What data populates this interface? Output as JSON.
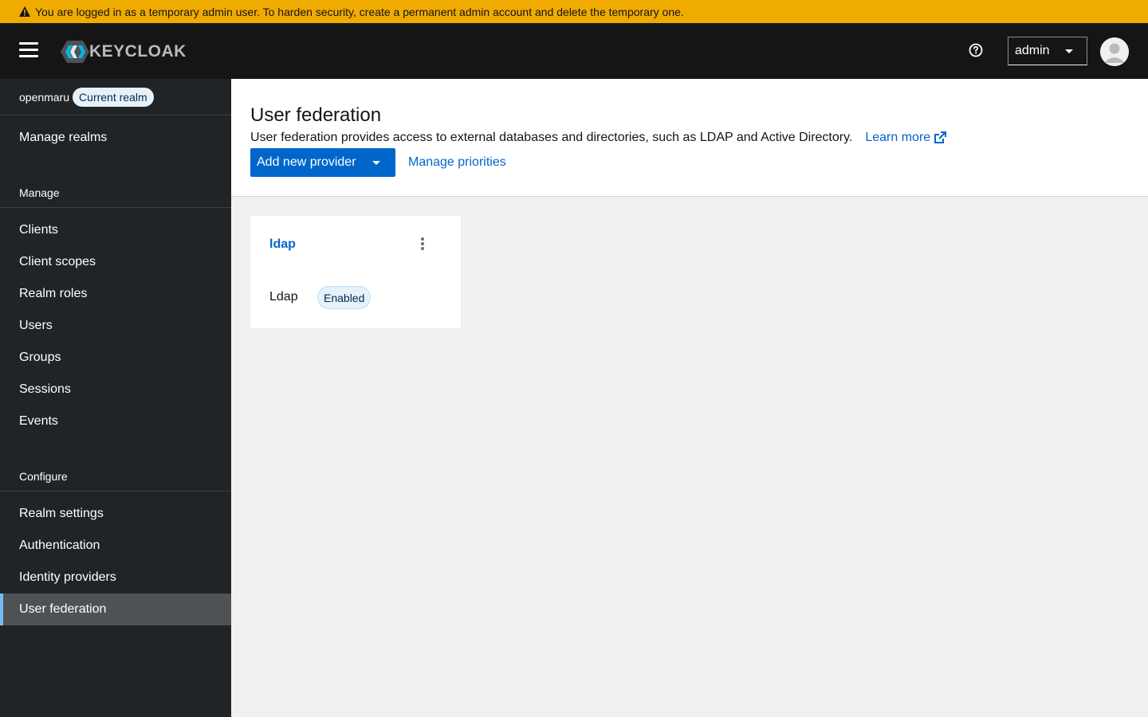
{
  "banner": {
    "icon": "warning-icon",
    "message": "You are logged in as a temporary admin user. To harden security, create a permanent admin account and delete the temporary one."
  },
  "masthead": {
    "logo_text": "KEYCLOAK",
    "user": "admin"
  },
  "sidebar": {
    "realm_name": "openmaru",
    "realm_badge": "Current realm",
    "manage_realms": "Manage realms",
    "sections": {
      "manage": "Manage",
      "configure": "Configure"
    },
    "manage_items": [
      {
        "label": "Clients"
      },
      {
        "label": "Client scopes"
      },
      {
        "label": "Realm roles"
      },
      {
        "label": "Users"
      },
      {
        "label": "Groups"
      },
      {
        "label": "Sessions"
      },
      {
        "label": "Events"
      }
    ],
    "configure_items": [
      {
        "label": "Realm settings"
      },
      {
        "label": "Authentication"
      },
      {
        "label": "Identity providers"
      },
      {
        "label": "User federation"
      }
    ],
    "active_item": "User federation"
  },
  "page": {
    "title": "User federation",
    "description": "User federation provides access to external databases and directories, such as LDAP and Active Directory.",
    "learn_more": "Learn more",
    "add_provider_label": "Add new provider",
    "manage_priorities_label": "Manage priorities"
  },
  "providers": [
    {
      "name": "ldap",
      "type": "Ldap",
      "status": "Enabled"
    }
  ],
  "colors": {
    "banner": "#f0ab00",
    "masthead": "#151515",
    "sidebar": "#212427",
    "primary": "#0066cc",
    "active_indicator": "#73bcf7"
  }
}
